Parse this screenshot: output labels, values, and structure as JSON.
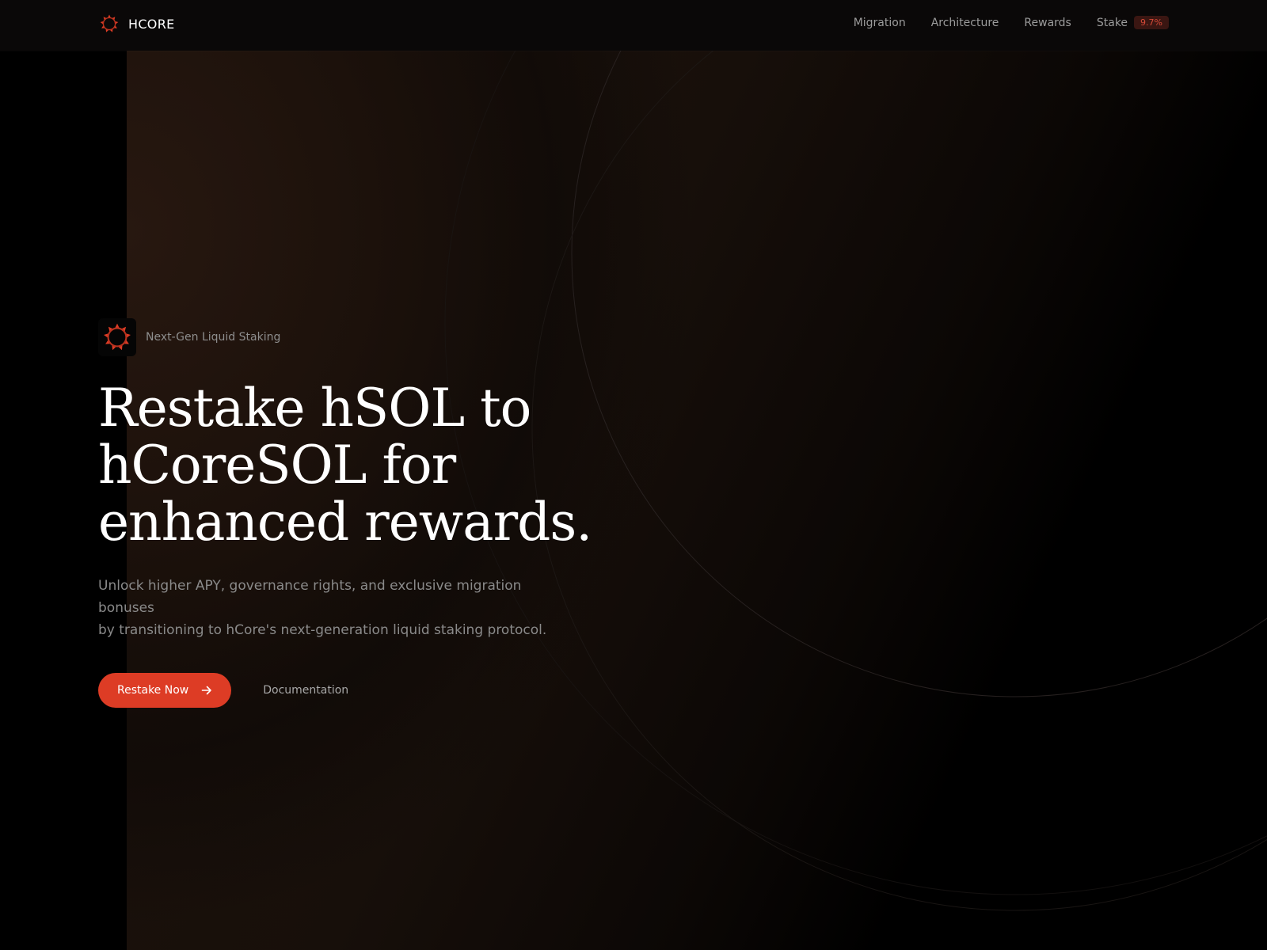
{
  "header": {
    "brand_name": "HCORE",
    "brand_icon": "hcore-logo-icon",
    "nav": [
      {
        "label": "Migration"
      },
      {
        "label": "Architecture"
      },
      {
        "label": "Rewards"
      },
      {
        "label": "Stake"
      }
    ],
    "stake_badge": "9.7%"
  },
  "hero": {
    "tag_icon": "hcore-logo-icon",
    "tagline": "Next-Gen Liquid Staking",
    "headline_lines": [
      "Restake hSOL to",
      "hCoreSOL for",
      "enhanced rewards."
    ],
    "subtext_lines": [
      "Unlock higher APY, governance rights, and exclusive migration bonuses",
      "by transitioning to hCore's next-generation liquid staking protocol."
    ],
    "primary_cta": "Restake Now",
    "primary_cta_icon": "arrow-right-icon",
    "secondary_cta": "Documentation"
  },
  "colors": {
    "accent": "#dd3c25",
    "background": "#000000",
    "text_primary": "#ffffff",
    "text_muted": "#8a8a8a"
  }
}
